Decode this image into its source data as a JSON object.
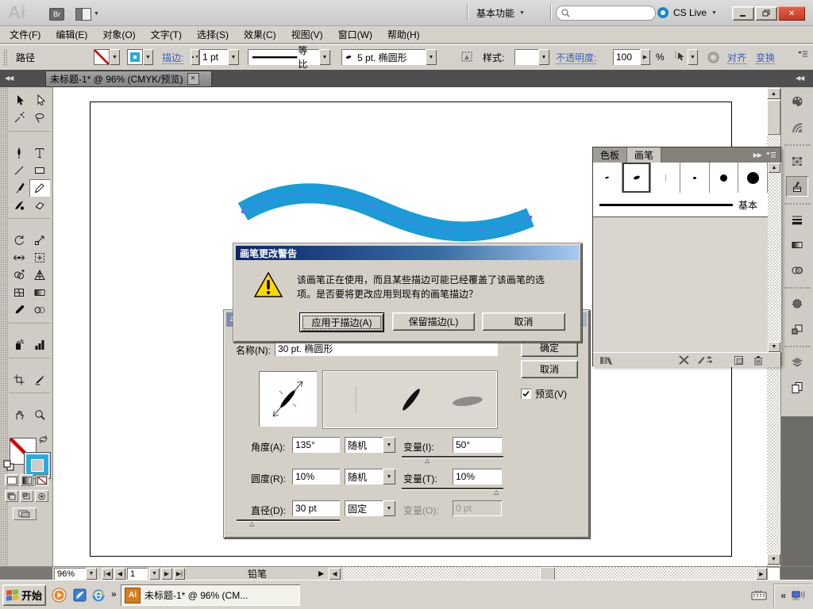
{
  "window": {
    "app_logo": "Ai",
    "bridge_button": "Br",
    "workspace_label": "基本功能",
    "cs_live_label": "CS Live",
    "search_placeholder": ""
  },
  "menubar": [
    "文件(F)",
    "编辑(E)",
    "对象(O)",
    "文字(T)",
    "选择(S)",
    "效果(C)",
    "视图(V)",
    "窗口(W)",
    "帮助(H)"
  ],
  "control_bar": {
    "context_label": "路径",
    "stroke_link": "描边:",
    "stroke_weight": "1 pt",
    "profile_label": "等比",
    "brush_label": "5 pt. 椭圆形",
    "style_label": "样式:",
    "opacity_link": "不透明度:",
    "opacity_value": "100",
    "opacity_unit": "%",
    "align_link": "对齐",
    "transform_link": "变换"
  },
  "document_tab": {
    "title": "未标题-1* @ 96%  (CMYK/预览)"
  },
  "toolbar_tools": [
    "selection",
    "direct-selection",
    "magic-wand",
    "lasso",
    "pen",
    "type",
    "line-segment",
    "rectangle",
    "paintbrush",
    "pencil",
    "blob-brush",
    "eraser",
    "rotate",
    "scale",
    "width",
    "free-transform",
    "shape-builder",
    "perspective-grid",
    "mesh",
    "gradient",
    "eyedropper",
    "blend",
    "symbol-sprayer",
    "graph",
    "artboard",
    "slice",
    "hand",
    "zoom"
  ],
  "selected_tool": "pencil",
  "dock_icons": [
    "color",
    "color-guide",
    "swatches",
    "brushes",
    "stroke",
    "gradient",
    "transparency",
    "symbols",
    "appearance",
    "layers",
    "artboards"
  ],
  "dock_active_icon": "brushes",
  "brushes_panel": {
    "tabs": [
      "色板",
      "画笔"
    ],
    "active_tab": "画笔",
    "brushes": [
      {
        "w": 5,
        "h": 2,
        "rot": -15,
        "color": "#000",
        "selected": false
      },
      {
        "w": 8,
        "h": 4,
        "rot": -20,
        "color": "#000",
        "selected": true
      },
      {
        "w": 1,
        "h": 11,
        "rot": 0,
        "color": "#b0ada6",
        "selected": false
      },
      {
        "w": 4,
        "h": 3,
        "rot": 0,
        "color": "#000",
        "selected": false
      },
      {
        "w": 9,
        "h": 9,
        "rot": 0,
        "color": "#000",
        "selected": false
      },
      {
        "w": 15,
        "h": 15,
        "rot": 0,
        "color": "#000",
        "selected": false
      }
    ],
    "basic_brush_label": "基本"
  },
  "warning_dialog": {
    "title": "画笔更改警告",
    "message_line1": "该画笔正在使用，而且某些描边可能已经覆盖了该画笔的选",
    "message_line2": "项。是否要将更改应用到现有的画笔描边？",
    "apply_button": "应用于描边(A)",
    "keep_button": "保留描边(L)",
    "cancel_button": "取消"
  },
  "brush_options_dialog": {
    "title_visible": "书",
    "name_label": "名称(N):",
    "name_value": "30 pt. 椭圆形",
    "ok_button": "确定",
    "cancel_button": "取消",
    "preview_label": "预览(V)",
    "angle_row": {
      "label": "角度(A):",
      "value": "135°",
      "mode": "随机",
      "variation_label": "变量(I):",
      "variation_value": "50°"
    },
    "roundness_row": {
      "label": "圆度(R):",
      "value": "10%",
      "mode": "随机",
      "variation_label": "变量(T):",
      "variation_value": "10%"
    },
    "diameter_row": {
      "label": "直径(D):",
      "value": "30 pt",
      "mode": "固定",
      "variation_label": "变量(O):",
      "variation_value": "0 pt"
    }
  },
  "status_bar": {
    "zoom_value": "96%",
    "artboard_value": "1",
    "tool_status": "铅笔"
  },
  "taskbar": {
    "start_label": "开始",
    "task_button_label": "未标题-1* @ 96% (CM...",
    "app_icon_label": "Ai"
  },
  "colors": {
    "wave": "#1b9bd8",
    "selection_path": "#7070e8",
    "stroke_swatch": "#29abe2",
    "active_title": "#0a246a",
    "close_button": "#cf4a31"
  }
}
